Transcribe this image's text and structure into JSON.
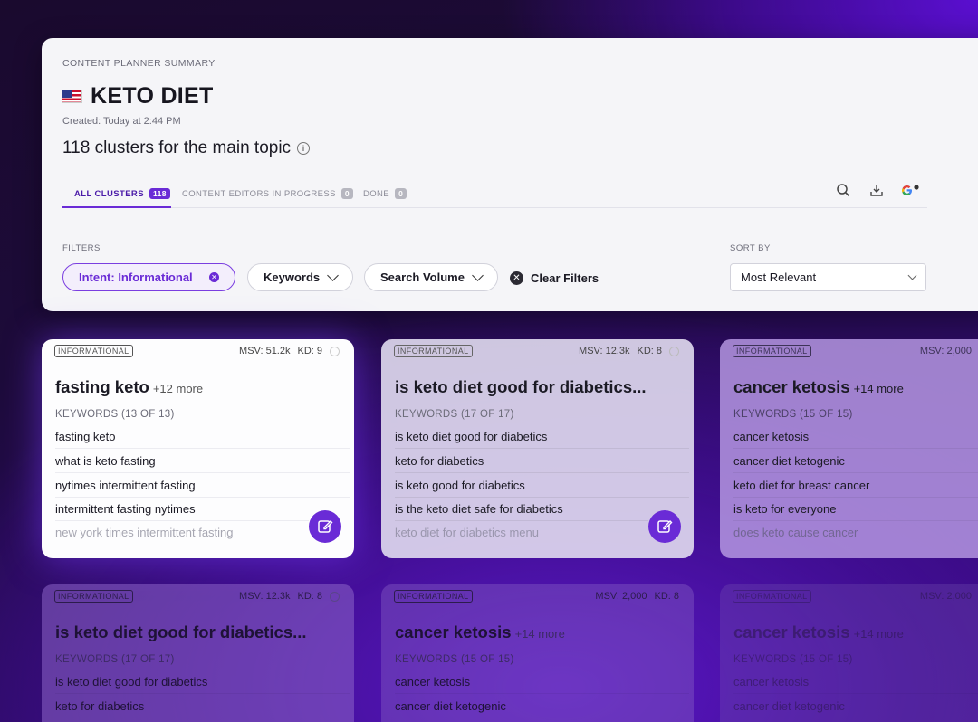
{
  "header": {
    "eyebrow": "CONTENT PLANNER SUMMARY",
    "title": "KETO DIET",
    "created": "Created: Today at 2:44 PM",
    "clusters_summary": "118 clusters for the main topic"
  },
  "tabs": [
    {
      "label": "ALL CLUSTERS",
      "count": "118",
      "active": true
    },
    {
      "label": "CONTENT EDITORS IN PROGRESS",
      "count": "0",
      "active": false
    },
    {
      "label": "DONE",
      "count": "0",
      "active": false
    }
  ],
  "tools": [
    "search-icon",
    "download-icon",
    "google-icon"
  ],
  "filters": {
    "label": "FILTERS",
    "intent_chip": "Intent: Informational",
    "keywords_dropdown": "Keywords",
    "volume_dropdown": "Search Volume",
    "clear": "Clear Filters"
  },
  "sort": {
    "label": "SORT BY",
    "value": "Most Relevant"
  },
  "cards": [
    {
      "tag": "INFORMATIONAL",
      "msv": "MSV: 51.2k",
      "kd": "KD: 9",
      "title": "fasting keto",
      "more": "+12 more",
      "kw_header": "KEYWORDS (13 OF 13)",
      "keywords": [
        "fasting keto",
        "what is keto fasting",
        "nytimes intermittent fasting",
        "intermittent fasting nytimes",
        "new york times intermittent fasting"
      ]
    },
    {
      "tag": "INFORMATIONAL",
      "msv": "MSV: 12.3k",
      "kd": "KD: 8",
      "title": "is keto diet good for diabetics...",
      "more": "",
      "kw_header": "KEYWORDS (17 OF 17)",
      "keywords": [
        "is keto diet good for diabetics",
        "keto for diabetics",
        "is keto good for diabetics",
        "is the keto diet safe for diabetics",
        "keto diet for diabetics menu"
      ]
    },
    {
      "tag": "INFORMATIONAL",
      "msv": "MSV: 2,000",
      "kd": "",
      "title": "cancer ketosis",
      "more": "+14 more",
      "kw_header": "KEYWORDS (15 OF 15)",
      "keywords": [
        "cancer ketosis",
        "cancer diet ketogenic",
        "keto diet for breast cancer",
        "is keto for everyone",
        "does keto cause cancer"
      ]
    },
    {
      "tag": "INFORMATIONAL",
      "msv": "MSV: 12.3k",
      "kd": "KD: 8",
      "title": "is keto diet good for diabetics...",
      "more": "",
      "kw_header": "KEYWORDS (17 OF 17)",
      "keywords": [
        "is keto diet good for diabetics",
        "keto for diabetics"
      ]
    },
    {
      "tag": "INFORMATIONAL",
      "msv": "MSV: 2,000",
      "kd": "KD: 8",
      "title": "cancer ketosis",
      "more": "+14 more",
      "kw_header": "KEYWORDS (15 OF 15)",
      "keywords": [
        "cancer ketosis",
        "cancer diet ketogenic"
      ]
    },
    {
      "tag": "INFORMATIONAL",
      "msv": "MSV: 2,000",
      "kd": "",
      "title": "cancer ketosis",
      "more": "+14 more",
      "kw_header": "KEYWORDS (15 OF 15)",
      "keywords": [
        "cancer ketosis",
        "cancer diet ketogenic"
      ]
    }
  ],
  "colors": {
    "accent": "#6a2bd6",
    "background": "#2c0b63"
  }
}
